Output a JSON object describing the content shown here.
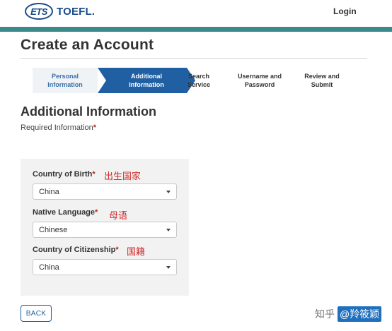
{
  "header": {
    "logo_ets": "ETS",
    "logo_toefl": "TOEFL.",
    "login_label": "Login"
  },
  "page_title": "Create an Account",
  "steps": [
    {
      "line1": "Personal",
      "line2": "Information",
      "state": "done"
    },
    {
      "line1": "Additional",
      "line2": "Information",
      "state": "active"
    },
    {
      "line1": "Search",
      "line2": "Service",
      "state": "upcoming"
    },
    {
      "line1": "Username and",
      "line2": "Password",
      "state": "upcoming"
    },
    {
      "line1": "Review and",
      "line2": "Submit",
      "state": "upcoming"
    }
  ],
  "section_title": "Additional Information",
  "required_note": "Required Information",
  "required_star": "*",
  "fields": [
    {
      "label": "Country of Birth",
      "star": "*",
      "annotation": "出生国家",
      "value": "China"
    },
    {
      "label": "Native Language",
      "star": "*",
      "annotation": "母语",
      "value": "Chinese"
    },
    {
      "label": "Country of Citizenship",
      "star": "*",
      "annotation": "国籍",
      "value": "China"
    }
  ],
  "back_label": "BACK",
  "watermark": {
    "site": "知乎",
    "user": "@羚筱颖"
  },
  "colors": {
    "brand": "#1a4a8a",
    "accent": "#1f5fa2",
    "teal_bar": "#3a8a8a",
    "required": "#b3261e",
    "annotation": "#d42a2a"
  }
}
